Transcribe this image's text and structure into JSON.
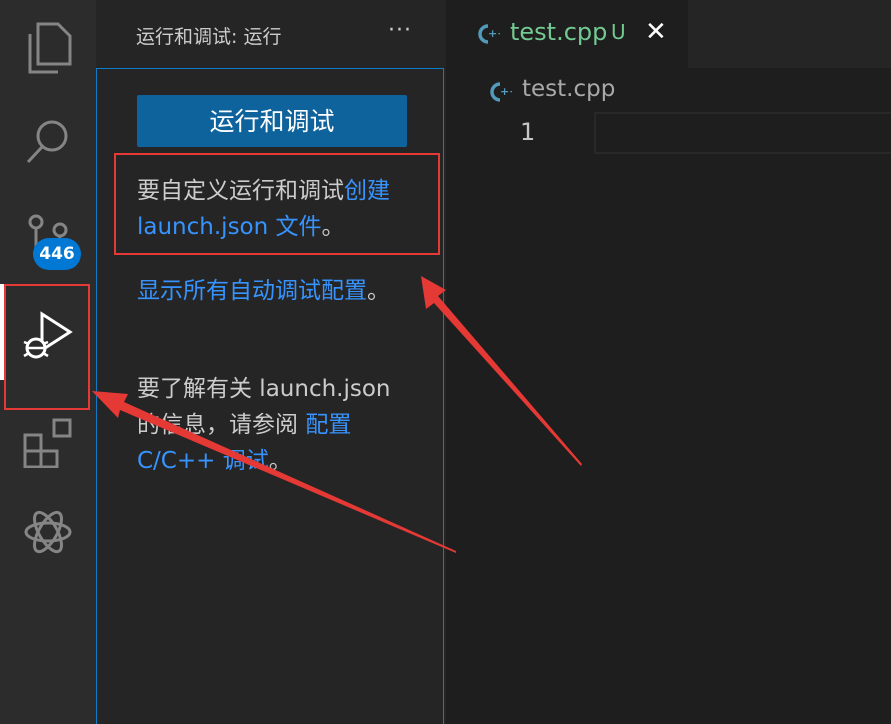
{
  "activity_bar": {
    "items": [
      {
        "icon": "files-icon"
      },
      {
        "icon": "search-icon"
      },
      {
        "icon": "source-control-icon",
        "badge": "446"
      },
      {
        "icon": "run-debug-icon",
        "active": true
      },
      {
        "icon": "extensions-icon"
      },
      {
        "icon": "openai-icon"
      }
    ],
    "accent_color": "#0078d4"
  },
  "sidebar": {
    "title": "运行和调试: 运行",
    "more_label": "···",
    "run_button_label": "运行和调试",
    "p1_text": "要自定义运行和调试",
    "p1_link": "创建 launch.json 文件",
    "p1_end": "。",
    "p2_link": "显示所有自动调试配置",
    "p2_end": "。",
    "p3_text": "要了解有关 launch.json 的信息，请参阅 ",
    "p3_link": "配置 C/C++ 调试",
    "p3_end": "。",
    "link_color": "#3794ff"
  },
  "tabs": [
    {
      "label": "test.cpp",
      "status": "U",
      "close": "✕",
      "icon": "cpp-file-icon"
    }
  ],
  "breadcrumb": {
    "label": "test.cpp",
    "icon": "cpp-file-icon"
  },
  "editor": {
    "line_numbers": [
      "1"
    ]
  },
  "annotations": {
    "highlight_color": "#e53935"
  }
}
